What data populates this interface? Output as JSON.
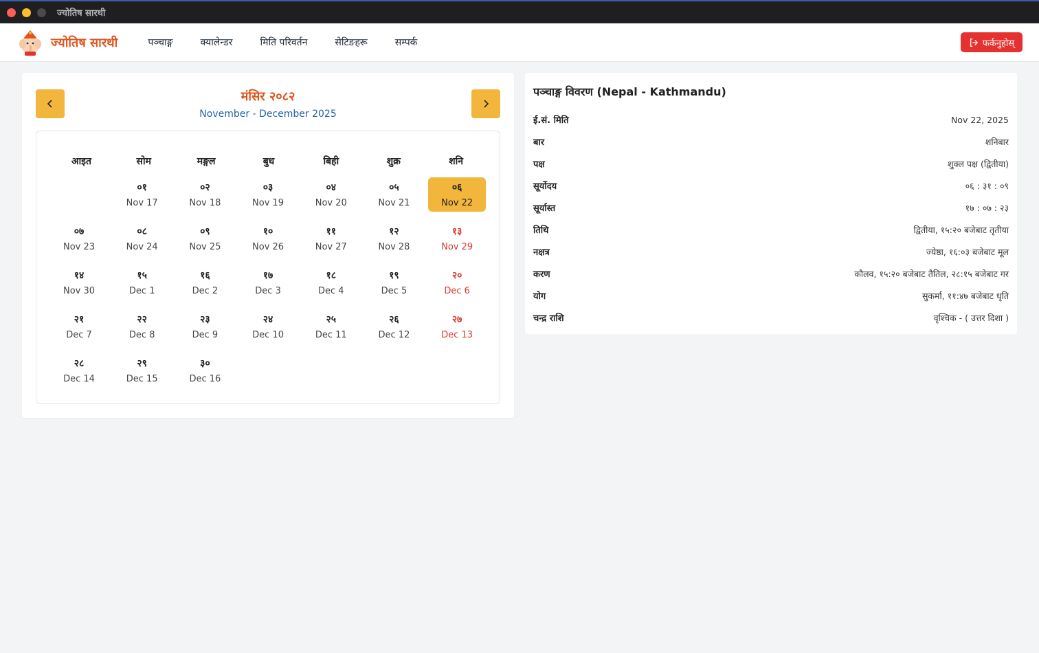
{
  "window": {
    "title": "ज्योतिष सारथी"
  },
  "header": {
    "brand": "ज्योतिष सारथी",
    "nav": [
      "पञ्चाङ्ग",
      "क्यालेन्डर",
      "मिति परिवर्तन",
      "सेटिङहरू",
      "सम्पर्क"
    ],
    "logout_label": "फर्कनुहोस्"
  },
  "calendar": {
    "month_np": "मंसिर २०८२",
    "month_en": "November - December 2025",
    "weekdays": [
      "आइत",
      "सोम",
      "मङ्गल",
      "बुध",
      "बिही",
      "शुक्र",
      "शनि"
    ],
    "days": [
      {
        "np": "",
        "en": ""
      },
      {
        "np": "०१",
        "en": "Nov 17"
      },
      {
        "np": "०२",
        "en": "Nov 18"
      },
      {
        "np": "०३",
        "en": "Nov 19"
      },
      {
        "np": "०४",
        "en": "Nov 20"
      },
      {
        "np": "०५",
        "en": "Nov 21"
      },
      {
        "np": "०६",
        "en": "Nov 22",
        "selected": true
      },
      {
        "np": "०७",
        "en": "Nov 23"
      },
      {
        "np": "०८",
        "en": "Nov 24"
      },
      {
        "np": "०९",
        "en": "Nov 25"
      },
      {
        "np": "१०",
        "en": "Nov 26"
      },
      {
        "np": "११",
        "en": "Nov 27"
      },
      {
        "np": "१२",
        "en": "Nov 28"
      },
      {
        "np": "१३",
        "en": "Nov 29"
      },
      {
        "np": "१४",
        "en": "Nov 30"
      },
      {
        "np": "१५",
        "en": "Dec 1"
      },
      {
        "np": "१६",
        "en": "Dec 2"
      },
      {
        "np": "१७",
        "en": "Dec 3"
      },
      {
        "np": "१८",
        "en": "Dec 4"
      },
      {
        "np": "१९",
        "en": "Dec 5"
      },
      {
        "np": "२०",
        "en": "Dec 6"
      },
      {
        "np": "२१",
        "en": "Dec 7"
      },
      {
        "np": "२२",
        "en": "Dec 8"
      },
      {
        "np": "२३",
        "en": "Dec 9"
      },
      {
        "np": "२४",
        "en": "Dec 10"
      },
      {
        "np": "२५",
        "en": "Dec 11"
      },
      {
        "np": "२६",
        "en": "Dec 12"
      },
      {
        "np": "२७",
        "en": "Dec 13"
      },
      {
        "np": "२८",
        "en": "Dec 14"
      },
      {
        "np": "२९",
        "en": "Dec 15"
      },
      {
        "np": "३०",
        "en": "Dec 16"
      }
    ]
  },
  "details": {
    "title": "पञ्चाङ्ग विवरण (Nepal - Kathmandu)",
    "rows": [
      {
        "label": "ई.सं. मिति",
        "value": "Nov 22, 2025"
      },
      {
        "label": "बार",
        "value": "शनिबार"
      },
      {
        "label": "पक्ष",
        "value": "शुक्ल पक्ष (द्वितीया)"
      },
      {
        "label": "सूर्योदय",
        "value": "०६ : ३१ : ०९"
      },
      {
        "label": "सूर्यास्त",
        "value": "१७ : ०७ : २३"
      },
      {
        "label": "तिथि",
        "value": "द्वितीया, १५:२० बजेबाट तृतीया"
      },
      {
        "label": "नक्षत्र",
        "value": "ज्येष्ठा, १६:०३ बजेबाट मूल"
      },
      {
        "label": "करण",
        "value": "कौलव, १५:२० बजेबाट तैतिल, २८:१५ बजेबाट गर"
      },
      {
        "label": "योग",
        "value": "सुकर्मा, ११:४७ बजेबाट धृति"
      },
      {
        "label": "चन्द्र राशि",
        "value": "वृश्चिक - ( उत्तर दिशा )"
      }
    ]
  },
  "colors": {
    "accent": "#f2b63d",
    "brand": "#e0541c",
    "saturday": "#d83a2e",
    "logout": "#e5312f",
    "month_en": "#2463a8"
  },
  "icons": {
    "prev": "chevron-left-icon",
    "next": "chevron-right-icon",
    "logout": "logout-icon",
    "logo": "ganesha-logo"
  }
}
